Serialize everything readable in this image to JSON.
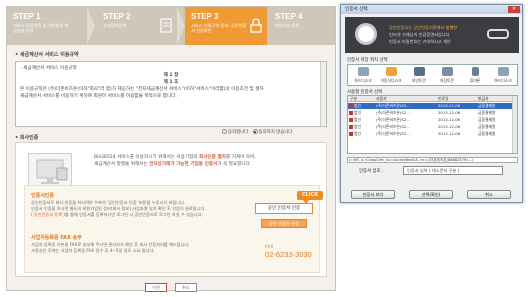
{
  "steps": [
    {
      "num": "STEP 1",
      "sub": "서비스 이용약관 및 개인정보 취급방침 동의"
    },
    {
      "num": "STEP 2",
      "sub": "상세정보입력"
    },
    {
      "num": "STEP 3",
      "sub": "서비스 이용규약 동의, 공인인증서 인증확인"
    },
    {
      "num": "STEP 4",
      "sub": "회원가입 완료"
    }
  ],
  "section_terms_title": "• 세금계산서 서비스 이용규약",
  "terms": {
    "heading": "- 세금계산서 서비스 이용규약",
    "chapter": "제 1 장",
    "article": "제 1 조",
    "body": "본 이용규칙은 (주)더존비즈온(이하\"회사\"라 함)가 제공하는 \"전자세금계산서 서비스\"(이하\"서비스\"이라함)의 이용조건 및 절차",
    "body2": "세금계산서 서비스를 이용하기 위하여 회원이 서비스를 이용함을 목적으로 합니다."
  },
  "agree": {
    "yes": "동의합니다",
    "no": "동의하지 않습니다"
  },
  "section_cert_title": "• 회사인증",
  "cert_desc": {
    "line1_pre": "Bill36524 서비스를 이용하시기 위해서는 이용기업의",
    "line1_hl": "회사인증 절차",
    "line1_post": "를 거쳐야 하며,",
    "line2_pre": "세금계산서 발행을 위해서는",
    "line2_hl": "전자상거래가 가능한 기업용 인증서",
    "line2_post": "가 꼭 필요합니다."
  },
  "must": {
    "title": "인증서인증",
    "t1": "공인인증서로 회사 인증을 하시려면 우측의 '공인인증서 인증' 버튼을 누루시기 바랍니다.",
    "t2": "인증서 인증을 하시면 별도의 회원가입된 정보(회사 정보) 사업자명 일치 확인 후 인증이 완료됩니다.",
    "t3_pre": "('",
    "t3_link": "공인인증서 등록",
    "t3_post": "')를 통해 인증서를 등록하시면 로그인 시 공인인증서로 로그인 하실 수 있습니다.",
    "fax_title": "사업자등록증 FAX 송부",
    "f1": "사업자 등록증 사본을 FAX로 송부해 주시면 관리자가 확인 후 회사 인증처리를 해드립니다.",
    "f2": "사용승인 후에는 사업자 등록증 FAX 접수 후 4~5일 정도 소요 됩니다."
  },
  "btn_cert_login": "공인 인증서 인증",
  "btn_cert_register": "공인 인증서 신청",
  "click_label": "CLICK",
  "fax": {
    "label": "FAX",
    "number": "02-6233-3030"
  },
  "bottom_btns": {
    "ok": "이전",
    "cancel": "취소"
  },
  "dialog": {
    "title": "인증서 선택",
    "banner1": "공인인증서는 공인인증기관에서 발행한",
    "banner2": "인터넷 거래상의 인감증명서입니다",
    "banner3": "인증서 비밀번호는 기억하시고 개인",
    "loc_label": "인증서 저장 위치 선택",
    "locations": [
      "하드디스크",
      "이동식디스크",
      "보안토큰",
      "저장토큰",
      "휴대폰",
      "하드디스크"
    ],
    "list_label": "사용할 인증서 선택",
    "columns": [
      "구분",
      "사용자",
      "만료일",
      "발급자"
    ],
    "rows": [
      [
        "법인",
        "(주)더존비즈온(S2...",
        "2013-12-06",
        "금융결제원"
      ],
      [
        "법인",
        "(주)더존비즈온(S2...",
        "2013-12-06",
        "금융결제원"
      ],
      [
        "법인",
        "(주)더존비즈온(S2...",
        "2013-12-06",
        "금융결제원"
      ],
      [
        "법인",
        "(주)더존비즈온(S2...",
        "2013-12-06",
        "금융결제원"
      ],
      [
        "법인",
        "(주)더존비즈온(S2...",
        "2013-12-06",
        "금융결제원"
      ]
    ],
    "path": "c=KR, o=CrossCert, ou=AccreditedCA, cn=()더존비즈온(888825791...)",
    "pw_label": "인증서 암호 :",
    "pw_value": "인증서 입력 ( 대소문자 구분 )",
    "btn_view": "인증서 보기",
    "btn_ok": "선택(확인)",
    "btn_cancel": "취소"
  },
  "colors": {
    "accent": "#f09a35",
    "step_bg": "#cfc7ba",
    "dialog_select": "#316ac5"
  }
}
